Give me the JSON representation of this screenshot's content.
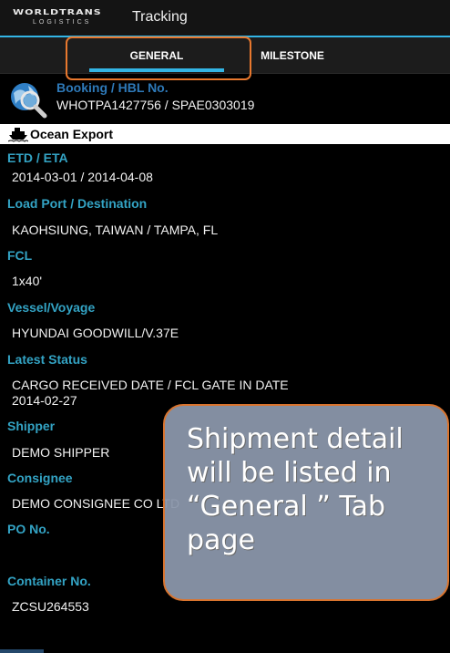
{
  "action_bar": {
    "logo_main": "WORLDTRANS",
    "logo_sub": "LOGISTICS",
    "title": "Tracking",
    "accent_color": "#33b5e5"
  },
  "tabs": [
    {
      "label": "GENERAL",
      "selected": true
    },
    {
      "label": "MILESTONE",
      "selected": false
    }
  ],
  "booking": {
    "icon": "globe-search-icon",
    "label": "Booking / HBL No.",
    "value": "WHOTPA1427756 / SPAE0303019"
  },
  "mode": {
    "icon": "ship-icon",
    "label": "Ocean Export"
  },
  "fields": [
    {
      "label": "ETD / ETA",
      "value": "2014-03-01 / 2014-04-08"
    },
    {
      "label": "Load Port / Destination",
      "value": "KAOHSIUNG, TAIWAN / TAMPA, FL"
    },
    {
      "label": "FCL",
      "value": "1x40'"
    },
    {
      "label": "Vessel/Voyage",
      "value": "HYUNDAI GOODWILL/V.37E"
    },
    {
      "label": "Latest Status",
      "value": "CARGO RECEIVED DATE / FCL GATE IN DATE\n2014-02-27"
    },
    {
      "label": "Shipper",
      "value": "DEMO SHIPPER"
    },
    {
      "label": "Consignee",
      "value": "DEMO CONSIGNEE CO LTD"
    },
    {
      "label": "PO No.",
      "value": ""
    },
    {
      "label": "Container No.",
      "value": "ZCSU264553"
    }
  ],
  "callout": {
    "text": "Shipment detail will be listed in “General ” Tab page"
  }
}
